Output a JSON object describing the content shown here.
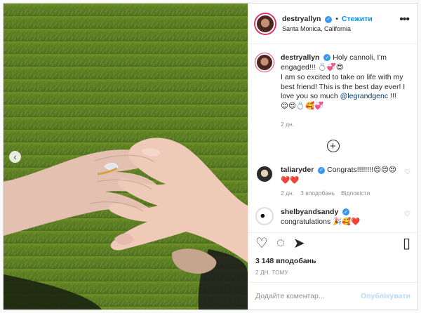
{
  "post": {
    "username": "destryallyn",
    "follow_label": "Стежити",
    "location": "Santa Monica, California",
    "caption_parts": [
      "Holy cannoli, I'm engaged!!! ",
      "💍💞😍",
      "I am so excited to take on life with my best friend! This is the best day ever! I love you so much ",
      "@legrandgenc",
      " !!!",
      "😊😍💍🥰💞"
    ],
    "caption_time": "2 дн.",
    "likes": "3 148 вподобань",
    "posted_time": "2 ДН. ТОМУ",
    "comment_placeholder": "Додайте коментар...",
    "publish_label": "Опублікувати"
  },
  "comments": [
    {
      "username": "taliaryder",
      "text": "Congrats!!!!!!!!😍😍😍❤️❤️",
      "time": "2 дн.",
      "likes": "3 вподобань",
      "reply_label": "Відповісти"
    },
    {
      "username": "shelbyandsandy",
      "text": "congratulations 🎉🥰❤️"
    }
  ],
  "icons": {
    "verified": "verified-badge-icon",
    "more": "more-options-icon",
    "add": "load-more-comments-icon",
    "like": "heart-outline-icon",
    "comment": "comment-outline-icon",
    "share": "paper-plane-icon",
    "save": "bookmark-outline-icon"
  },
  "colors": {
    "accent": "#0095f6",
    "verified": "#3897f0",
    "muted": "#8e8e8e"
  }
}
